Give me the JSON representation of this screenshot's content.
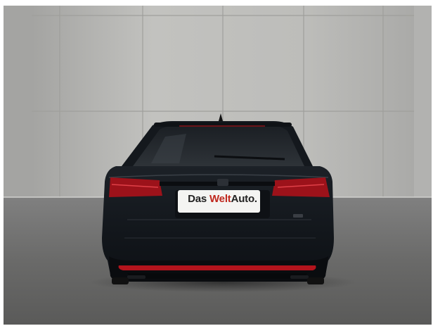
{
  "photo": {
    "subject": "car-rear-view",
    "license_plate": {
      "word_1": "Das ",
      "word_2": "Welt",
      "word_3": "Auto.",
      "accent_color": "#c0281e"
    },
    "colors": {
      "car_body": "#14181d",
      "taillight": "#b3141c",
      "wall": "#b9b9b6",
      "floor": "#6e6e6c"
    }
  }
}
